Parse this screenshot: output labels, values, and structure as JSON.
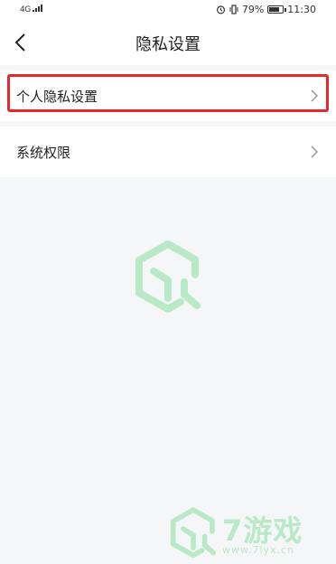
{
  "status_bar": {
    "network": "4G",
    "battery": "79%",
    "battery_level": 0.79,
    "time": "11:30"
  },
  "nav": {
    "title": "隐私设置"
  },
  "settings": {
    "items": [
      {
        "label": "个人隐私设置"
      },
      {
        "label": "系统权限"
      }
    ]
  },
  "watermark": {
    "brand": "7游戏",
    "url": "www.7lyx.cn"
  },
  "colors": {
    "highlight": "#e8282b",
    "logo_green": "#b9e9c7"
  }
}
